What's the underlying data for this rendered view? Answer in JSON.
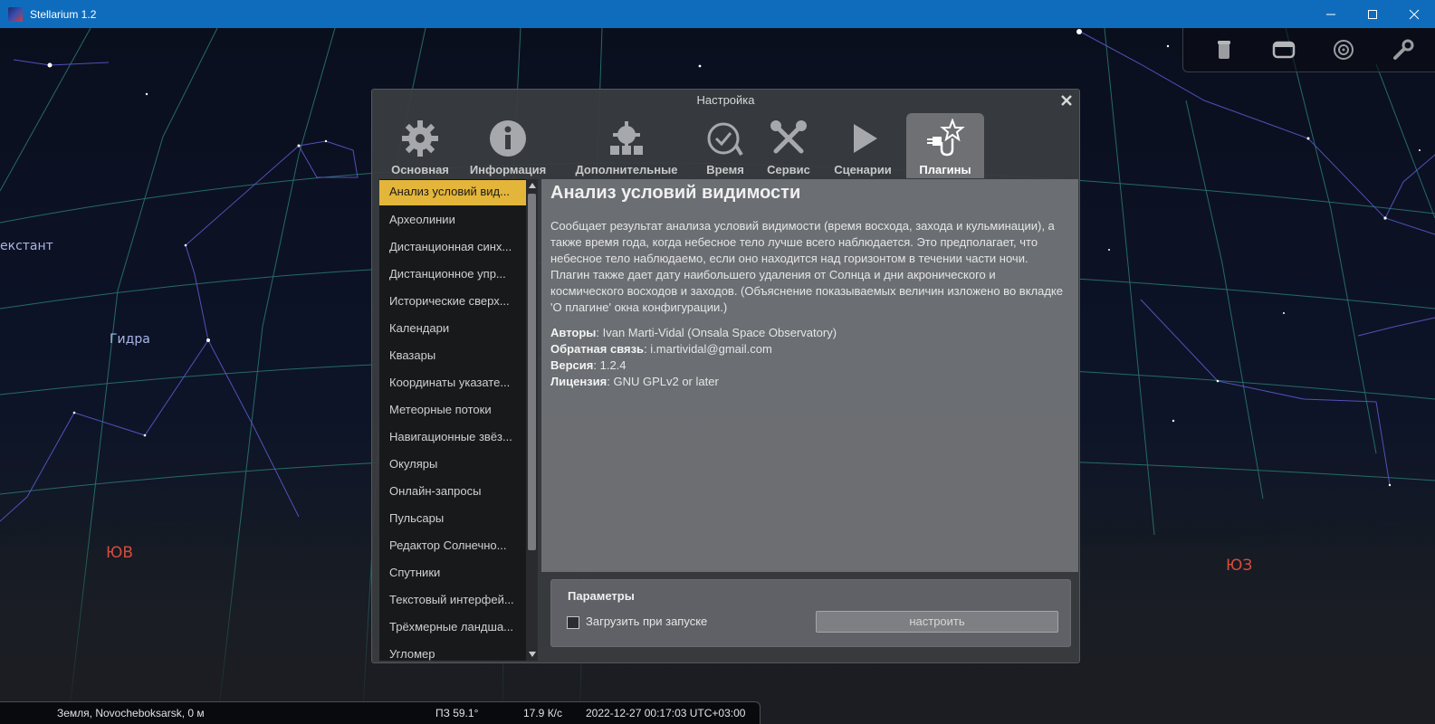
{
  "window": {
    "title": "Stellarium 1.2",
    "controls": [
      "minimize",
      "maximize",
      "close"
    ]
  },
  "sky": {
    "labels": {
      "hydra": "Гидра",
      "sextant": "екстант",
      "southeast": "ЮВ",
      "southwest": "ЮЗ"
    }
  },
  "top_toolbar": {
    "icons": [
      "trash-can-icon",
      "window-icon",
      "target-icon",
      "wrench-icon"
    ]
  },
  "dialog": {
    "title": "Настройка",
    "tabs": [
      {
        "label": "Основная",
        "icon": "gear-icon"
      },
      {
        "label": "Информация",
        "icon": "info-icon"
      },
      {
        "label": "Дополнительные",
        "icon": "extras-icon"
      },
      {
        "label": "Время",
        "icon": "clock-icon"
      },
      {
        "label": "Сервис",
        "icon": "tools-icon"
      },
      {
        "label": "Сценарии",
        "icon": "play-icon"
      },
      {
        "label": "Плагины",
        "icon": "plugin-icon",
        "active": true
      }
    ],
    "plugins": [
      "Анализ условий вид...",
      "Археолинии",
      "Дистанционная синх...",
      "Дистанционное упр...",
      "Исторические сверх...",
      "Календари",
      "Квазары",
      "Координаты указате...",
      "Метеорные потоки",
      "Навигационные звёз...",
      "Окуляры",
      "Онлайн-запросы",
      "Пульсары",
      "Редактор Солнечно...",
      "Спутники",
      "Текстовый интерфей...",
      "Трёхмерные ландша...",
      "Угломер"
    ],
    "selected_plugin_index": 0,
    "detail": {
      "title": "Анализ условий видимости",
      "description": "Сообщает результат анализа условий видимости (время восхода, захода и кульминации), а также время года, когда небесное тело лучше всего наблюдается. Это предполагает, что небесное тело наблюдаемо, если оно находится над горизонтом в течении части ночи. Плагин также дает дату наибольшего удаления от Солнца и дни акронического и космического восходов и заходов. (Объяснение показываемых величин изложено во вкладке 'О плагине' окна конфигурации.)",
      "authors_label": "Авторы",
      "authors_value": ": Ivan Marti-Vidal (Onsala Space Observatory)",
      "feedback_label": "Обратная связь",
      "feedback_value": ": i.martividal@gmail.com",
      "version_label": "Версия",
      "version_value": ": 1.2.4",
      "license_label": "Лицензия",
      "license_value": ": GNU GPLv2 or later"
    },
    "params": {
      "title": "Параметры",
      "load_on_start_label": "Загрузить при запуске",
      "load_on_start_checked": false,
      "configure_button": "настроить"
    }
  },
  "statusbar": {
    "location": "Земля, Novocheboksarsk, 0 м",
    "fov": "ПЗ 59.1°",
    "fps": "17.9 К/с",
    "datetime": "2022-12-27 00:17:03 UTC+03:00"
  }
}
